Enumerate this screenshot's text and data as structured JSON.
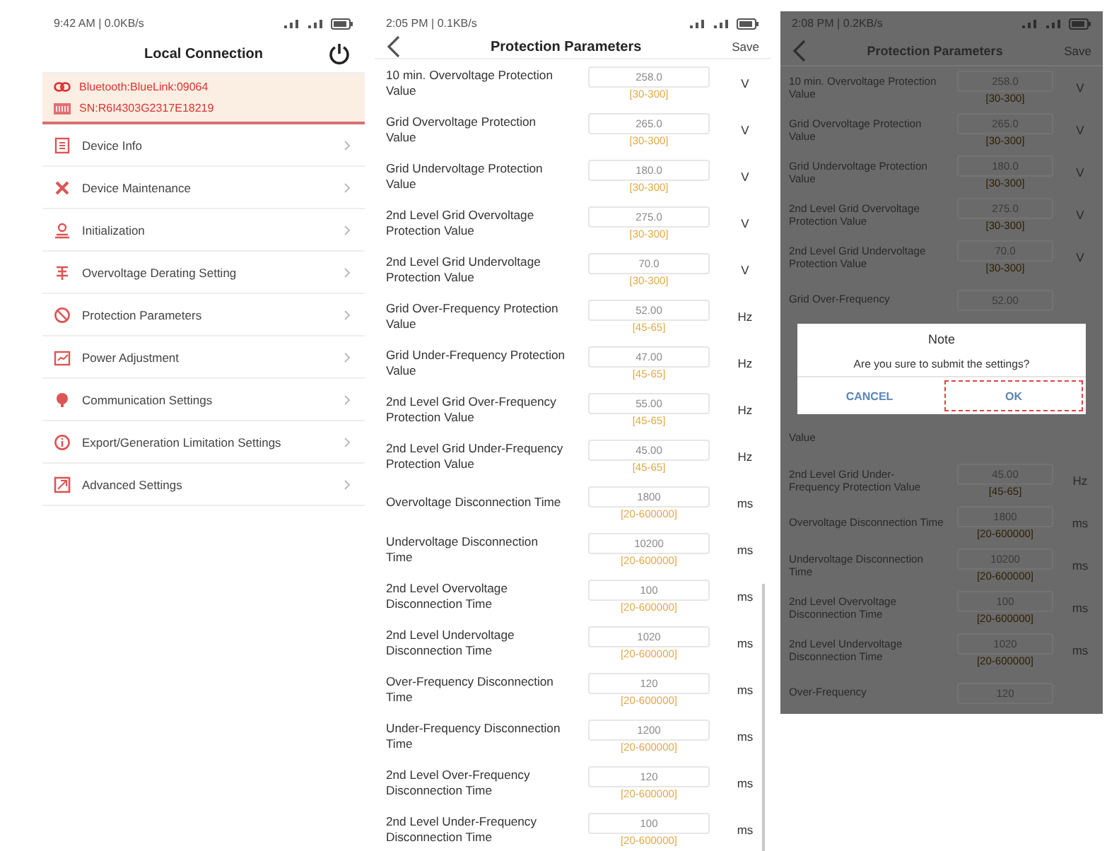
{
  "local_connection": {
    "status_text": "9:42 AM | 0.0KB/s",
    "title": "Local Connection",
    "connection": {
      "bluetooth": "Bluetooth:BlueLink:09064",
      "serial": "SN:R6I4303G2317E18219"
    },
    "items": [
      {
        "label": "Device Info"
      },
      {
        "label": "Device Maintenance"
      },
      {
        "label": "Initialization"
      },
      {
        "label": "Overvoltage Derating Setting"
      },
      {
        "label": "Protection Parameters"
      },
      {
        "label": "Power Adjustment"
      },
      {
        "label": "Communication Settings"
      },
      {
        "label": "Export/Generation Limitation Settings"
      },
      {
        "label": "Advanced Settings"
      }
    ]
  },
  "protection_parameters": {
    "status_text": "2:05 PM | 0.1KB/s",
    "title": "Protection Parameters",
    "save": "Save",
    "rows": [
      {
        "label": "10 min. Overvoltage Protection Value",
        "value": "258.0",
        "range": "[30-300]",
        "unit": "V"
      },
      {
        "label": "Grid Overvoltage Protection Value",
        "value": "265.0",
        "range": "[30-300]",
        "unit": "V"
      },
      {
        "label": "Grid Undervoltage Protection Value",
        "value": "180.0",
        "range": "[30-300]",
        "unit": "V"
      },
      {
        "label": "2nd Level Grid Overvoltage Protection Value",
        "value": "275.0",
        "range": "[30-300]",
        "unit": "V"
      },
      {
        "label": "2nd Level Grid Undervoltage Protection Value",
        "value": "70.0",
        "range": "[30-300]",
        "unit": "V"
      },
      {
        "label": "Grid Over-Frequency Protection Value",
        "value": "52.00",
        "range": "[45-65]",
        "unit": "Hz"
      },
      {
        "label": "Grid Under-Frequency Protection Value",
        "value": "47.00",
        "range": "[45-65]",
        "unit": "Hz"
      },
      {
        "label": "2nd Level Grid Over-Frequency Protection Value",
        "value": "55.00",
        "range": "[45-65]",
        "unit": "Hz"
      },
      {
        "label": "2nd Level Grid Under-Frequency Protection Value",
        "value": "45.00",
        "range": "[45-65]",
        "unit": "Hz"
      },
      {
        "label": "Overvoltage Disconnection Time",
        "value": "1800",
        "range": "[20-600000]",
        "unit": "ms"
      },
      {
        "label": "Undervoltage Disconnection Time",
        "value": "10200",
        "range": "[20-600000]",
        "unit": "ms"
      },
      {
        "label": "2nd Level Overvoltage Disconnection Time",
        "value": "100",
        "range": "[20-600000]",
        "unit": "ms"
      },
      {
        "label": "2nd Level Undervoltage Disconnection Time",
        "value": "1020",
        "range": "[20-600000]",
        "unit": "ms"
      },
      {
        "label": "Over-Frequency Disconnection Time",
        "value": "120",
        "range": "[20-600000]",
        "unit": "ms"
      },
      {
        "label": "Under-Frequency Disconnection Time",
        "value": "1200",
        "range": "[20-600000]",
        "unit": "ms"
      },
      {
        "label": "2nd Level Over-Frequency Disconnection Time",
        "value": "120",
        "range": "[20-600000]",
        "unit": "ms"
      },
      {
        "label": "2nd Level Under-Frequency Disconnection Time",
        "value": "100",
        "range": "[20-600000]",
        "unit": "ms"
      }
    ]
  },
  "confirm_screen": {
    "status_text": "2:08 PM | 0.2KB/s",
    "title": "Protection Parameters",
    "save": "Save",
    "rows_above": [
      {
        "label": "10 min. Overvoltage Protection Value",
        "value": "258.0",
        "range": "[30-300]",
        "unit": "V"
      },
      {
        "label": "Grid Overvoltage Protection Value",
        "value": "265.0",
        "range": "[30-300]",
        "unit": "V"
      },
      {
        "label": "Grid Undervoltage Protection Value",
        "value": "180.0",
        "range": "[30-300]",
        "unit": "V"
      },
      {
        "label": "2nd Level Grid Overvoltage Protection Value",
        "value": "275.0",
        "range": "[30-300]",
        "unit": "V"
      },
      {
        "label": "2nd Level Grid Undervoltage Protection Value",
        "value": "70.0",
        "range": "[30-300]",
        "unit": "V"
      },
      {
        "label": "Grid Over-Frequency",
        "value": "52.00"
      }
    ],
    "dialog": {
      "title": "Note",
      "message": "Are you sure to submit the settings?",
      "buttons": [
        {
          "label": "CANCEL",
          "focused": false
        },
        {
          "label": "OK",
          "focused": true
        }
      ]
    },
    "rows_below": [
      {
        "label": "Value"
      },
      {
        "label": "2nd Level Grid Under-Frequency Protection Value",
        "value": "45.00",
        "range": "[45-65]",
        "unit": "Hz"
      },
      {
        "label": "Overvoltage Disconnection Time",
        "value": "1800",
        "range": "[20-600000]",
        "unit": "ms"
      },
      {
        "label": "Undervoltage Disconnection Time",
        "value": "10200",
        "range": "[20-600000]",
        "unit": "ms"
      },
      {
        "label": "2nd Level Overvoltage Disconnection Time",
        "value": "100",
        "range": "[20-600000]",
        "unit": "ms"
      },
      {
        "label": "2nd Level Undervoltage Disconnection Time",
        "value": "1020",
        "range": "[20-600000]",
        "unit": "ms"
      },
      {
        "label": "Over-Frequency",
        "value": "120"
      }
    ]
  }
}
